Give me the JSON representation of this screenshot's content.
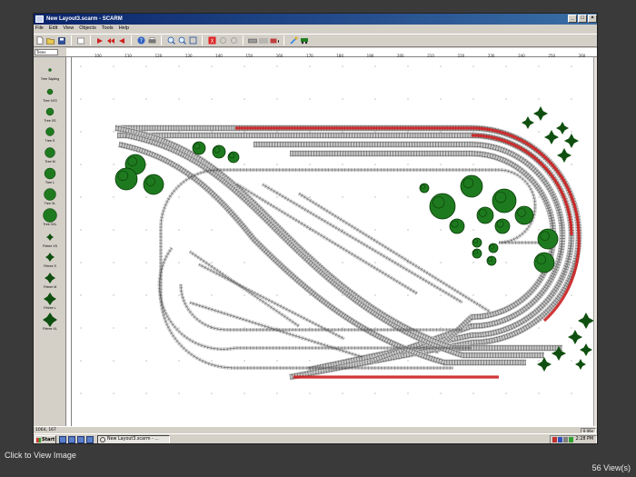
{
  "window": {
    "title": "New Layout3.scarm - SCARM",
    "buttons": [
      "_",
      "□",
      "×"
    ]
  },
  "menu": [
    "File",
    "Edit",
    "View",
    "Objects",
    "Tools",
    "Help"
  ],
  "toolbar": {
    "icons": [
      "new-icon",
      "open-icon",
      "save-icon",
      "undo-icon",
      "play-icon",
      "rewind-icon",
      "stop-icon",
      "help-icon",
      "zoom-in-icon",
      "zoom-out-icon",
      "zoom-fit-icon",
      "tools-icon",
      "train-icon"
    ]
  },
  "palette": {
    "layer": "Trees",
    "items": [
      {
        "label": "Tree Sapling"
      },
      {
        "label": "Tree XXS"
      },
      {
        "label": "Tree XS"
      },
      {
        "label": "Tree S"
      },
      {
        "label": "Tree M"
      },
      {
        "label": "Tree L"
      },
      {
        "label": "Tree XL"
      },
      {
        "label": "Tree XXL"
      },
      {
        "label": "Firtree XS"
      },
      {
        "label": "Firtree S"
      },
      {
        "label": "Firtree M"
      },
      {
        "label": "Firtree L"
      },
      {
        "label": "Firtree XL"
      }
    ]
  },
  "ruler": {
    "marks": [
      "100",
      "110",
      "120",
      "130",
      "140",
      "150",
      "160",
      "170",
      "180",
      "190",
      "200",
      "210",
      "220",
      "230",
      "240",
      "250",
      "260"
    ]
  },
  "status": {
    "coords": "1064, 167",
    "zoom": "0.46x"
  },
  "taskbar": {
    "start": "Start",
    "task": "New Layout3.scarm - ...",
    "clock": "2:28 PM"
  },
  "viewer": {
    "click_label": "Click to View Image",
    "views": "56 View(s)"
  },
  "colors": {
    "track_rail": "#555555",
    "track_bed": "#c8c8c8",
    "track_hidden": "#cc2020",
    "tree": "#1e7a1e",
    "firtree": "#0f4f0f"
  }
}
